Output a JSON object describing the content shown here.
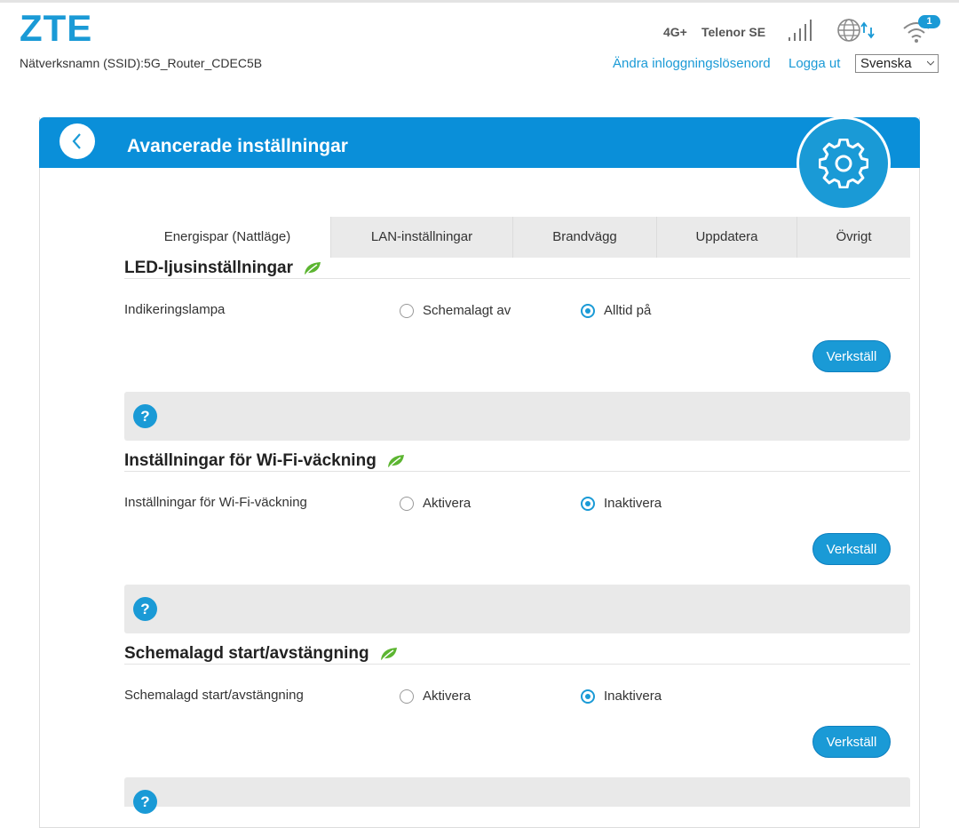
{
  "header": {
    "logo": "ZTE",
    "ssid": "Nätverksnamn (SSID):5G_Router_CDEC5B",
    "network_type": "4G+",
    "carrier": "Telenor SE",
    "wifi_clients": "1",
    "change_password": "Ändra inloggningslösenord",
    "logout": "Logga ut",
    "language": "Svenska"
  },
  "page": {
    "title": "Avancerade inställningar"
  },
  "tabs": [
    {
      "label": "Energispar (Nattläge)",
      "active": true
    },
    {
      "label": "LAN-inställningar"
    },
    {
      "label": "Brandvägg"
    },
    {
      "label": "Uppdatera"
    },
    {
      "label": "Övrigt"
    }
  ],
  "sections": [
    {
      "title": "LED-ljusinställningar",
      "row_label": "Indikeringslampa",
      "option1": "Schemalagt av",
      "option2": "Alltid på",
      "selected": 2,
      "apply": "Verkställ",
      "help": "?"
    },
    {
      "title": "Inställningar för Wi-Fi-väckning",
      "row_label": "Inställningar för Wi-Fi-väckning",
      "option1": "Aktivera",
      "option2": "Inaktivera",
      "selected": 2,
      "apply": "Verkställ",
      "help": "?"
    },
    {
      "title": "Schemalagd start/avstängning",
      "row_label": "Schemalagd start/avstängning",
      "option1": "Aktivera",
      "option2": "Inaktivera",
      "selected": 2,
      "apply": "Verkställ",
      "help": "?"
    }
  ],
  "colors": {
    "accent": "#1a9ad6",
    "header_bar": "#0a8fd9",
    "leaf": "#5cb531"
  }
}
